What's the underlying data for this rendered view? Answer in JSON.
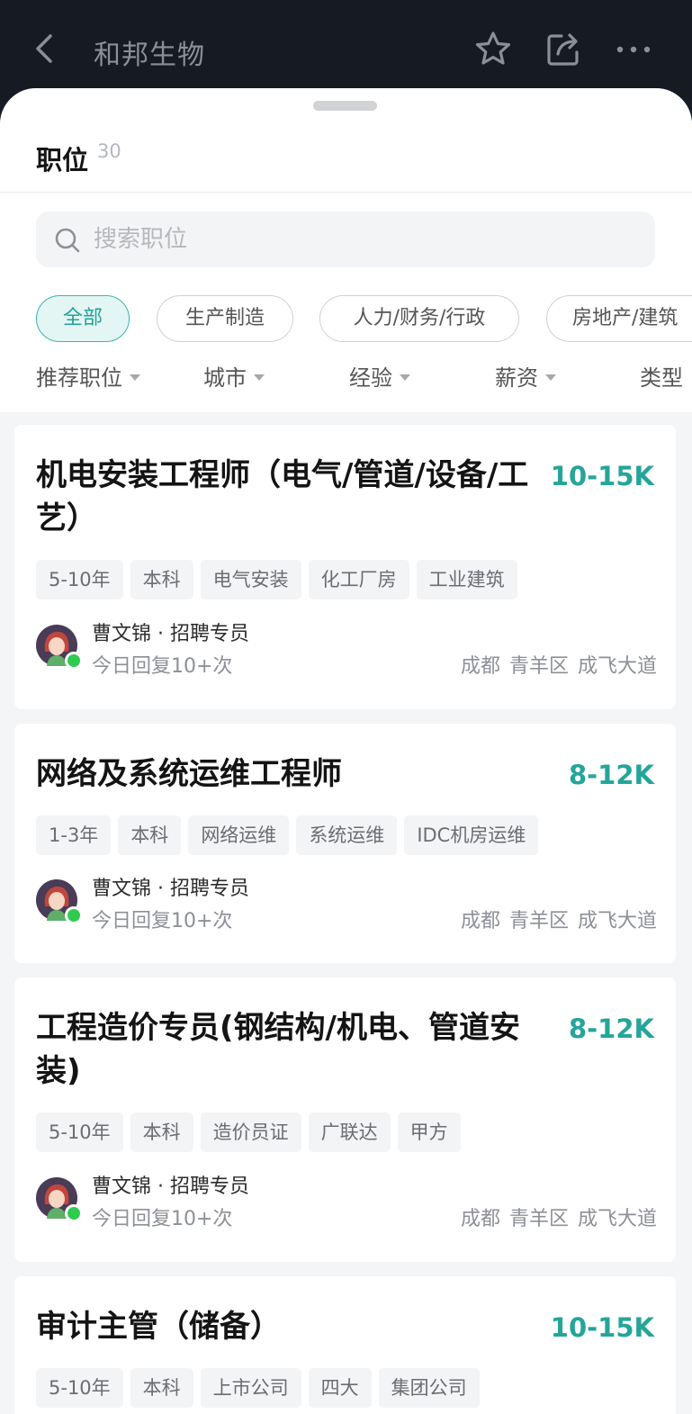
{
  "header": {
    "company": "和邦生物",
    "icons": {
      "back": "back-chevron-icon",
      "star": "star-icon",
      "share": "share-icon",
      "more": "more-dots-icon"
    }
  },
  "section": {
    "title": "职位",
    "count": "30"
  },
  "search": {
    "placeholder": "搜索职位"
  },
  "categories": [
    {
      "label": "全部",
      "active": true
    },
    {
      "label": "生产制造",
      "active": false
    },
    {
      "label": "人力/财务/行政",
      "active": false
    },
    {
      "label": "房地产/建筑",
      "active": false
    }
  ],
  "filters": [
    {
      "label": "推荐职位"
    },
    {
      "label": "城市"
    },
    {
      "label": "经验"
    },
    {
      "label": "薪资"
    },
    {
      "label": "类型"
    }
  ],
  "colors": {
    "accent": "#25a59a",
    "online": "#2ecb4f",
    "topbar": "#161a23"
  },
  "jobs": [
    {
      "title": "机电安装工程师（电气/管道/设备/工艺）",
      "salary": "10-15K",
      "tags": [
        "5-10年",
        "本科",
        "电气安装",
        "化工厂房",
        "工业建筑"
      ],
      "recruiter": "曹文锦 · 招聘专员",
      "reply": "今日回复10+次",
      "location": [
        "成都",
        "青羊区",
        "成飞大道"
      ]
    },
    {
      "title": "网络及系统运维工程师",
      "salary": "8-12K",
      "tags": [
        "1-3年",
        "本科",
        "网络运维",
        "系统运维",
        "IDC机房运维"
      ],
      "recruiter": "曹文锦 · 招聘专员",
      "reply": "今日回复10+次",
      "location": [
        "成都",
        "青羊区",
        "成飞大道"
      ]
    },
    {
      "title": "工程造价专员(钢结构/机电、管道安装)",
      "salary": "8-12K",
      "tags": [
        "5-10年",
        "本科",
        "造价员证",
        "广联达",
        "甲方"
      ],
      "recruiter": "曹文锦 · 招聘专员",
      "reply": "今日回复10+次",
      "location": [
        "成都",
        "青羊区",
        "成飞大道"
      ]
    },
    {
      "title": "审计主管（储备）",
      "salary": "10-15K",
      "tags": [
        "5-10年",
        "本科",
        "上市公司",
        "四大",
        "集团公司"
      ]
    }
  ]
}
